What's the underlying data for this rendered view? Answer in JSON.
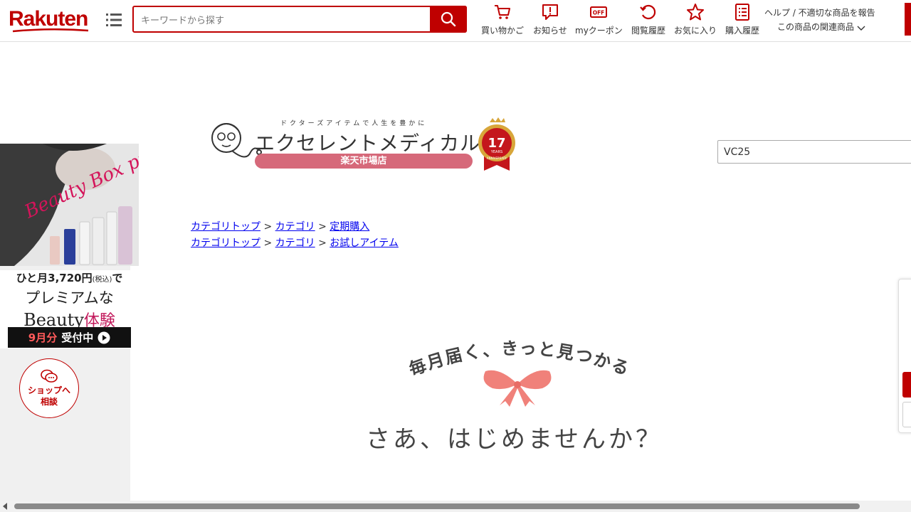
{
  "header": {
    "logo": "Rakuten",
    "search_placeholder": "キーワードから探す",
    "nav": [
      {
        "label": "買い物かご",
        "icon": "cart-icon"
      },
      {
        "label": "お知らせ",
        "icon": "notice-icon"
      },
      {
        "label": "myクーポン",
        "icon": "coupon-icon"
      },
      {
        "label": "閲覧履歴",
        "icon": "history-icon"
      },
      {
        "label": "お気に入り",
        "icon": "star-icon"
      },
      {
        "label": "購入履歴",
        "icon": "purchase-history-icon"
      }
    ],
    "help_link": "ヘルプ / 不適切な商品を報告",
    "related_link": "この商品の関連商品",
    "coupon_icon_text": "OFF"
  },
  "ad": {
    "script_title": "Beauty Box premium",
    "line1": "ひと月3,720円",
    "line1_tax": "(税込)",
    "line1_suffix": "で",
    "line2": "プレミアムな",
    "line3a": "Beauty",
    "line3b": "体験",
    "cta_red": "9月分",
    "cta_white": "受付中"
  },
  "consult": {
    "line1": "ショップへ",
    "line2": "相談"
  },
  "shop": {
    "tagline": "ドクターズアイテムで人生を豊かに",
    "name": "エクセレントメディカル",
    "pill": "楽天市場店",
    "anniversary_number": "17",
    "anniversary_years": "YEARS",
    "anniversary_text": "ANNIVERSARY"
  },
  "side_search_value": "VC25",
  "breadcrumbs": [
    {
      "top": "カテゴリトップ",
      "cat": "カテゴリ",
      "leaf": "定期購入"
    },
    {
      "top": "カテゴリトップ",
      "cat": "カテゴリ",
      "leaf": "お試しアイテム"
    }
  ],
  "breadcrumb_sep": ">",
  "hero": {
    "arc_text": "毎月届く、きっと見つかる",
    "main_text": "さあ、はじめませんか？"
  },
  "colors": {
    "brand": "#bf0000",
    "pill": "#d6697a",
    "ribbon": "#f0817a",
    "link": "#0000ee"
  }
}
